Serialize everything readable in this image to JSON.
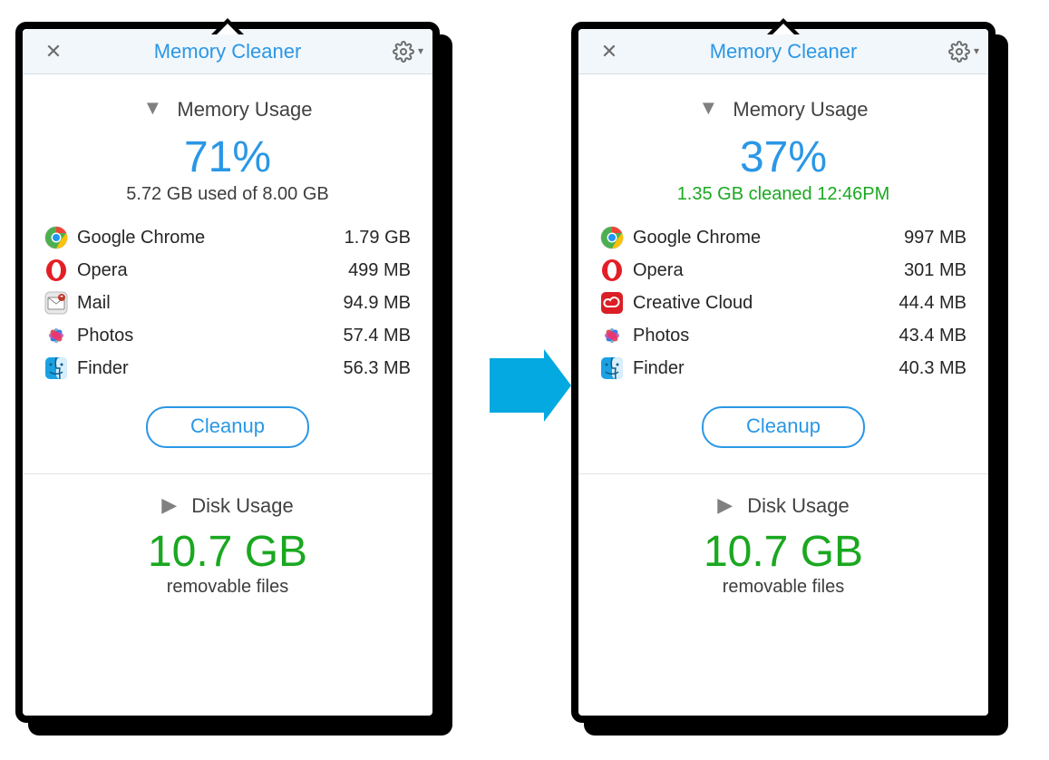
{
  "left": {
    "title": "Memory Cleaner",
    "memory": {
      "section_label": "Memory Usage",
      "percent": "71%",
      "subline": "5.72 GB used of 8.00 GB",
      "subline_green": false,
      "cleanup_label": "Cleanup",
      "apps": [
        {
          "icon": "chrome",
          "name": "Google Chrome",
          "value": "1.79 GB"
        },
        {
          "icon": "opera",
          "name": "Opera",
          "value": "499 MB"
        },
        {
          "icon": "mail",
          "name": "Mail",
          "value": "94.9 MB"
        },
        {
          "icon": "photos",
          "name": "Photos",
          "value": "57.4 MB"
        },
        {
          "icon": "finder",
          "name": "Finder",
          "value": "56.3 MB"
        }
      ]
    },
    "disk": {
      "section_label": "Disk Usage",
      "big": "10.7 GB",
      "sub": "removable files"
    }
  },
  "right": {
    "title": "Memory Cleaner",
    "memory": {
      "section_label": "Memory Usage",
      "percent": "37%",
      "subline": "1.35 GB cleaned 12:46PM",
      "subline_green": true,
      "cleanup_label": "Cleanup",
      "apps": [
        {
          "icon": "chrome",
          "name": "Google Chrome",
          "value": "997 MB"
        },
        {
          "icon": "opera",
          "name": "Opera",
          "value": "301 MB"
        },
        {
          "icon": "creativecloud",
          "name": "Creative Cloud",
          "value": "44.4 MB"
        },
        {
          "icon": "photos",
          "name": "Photos",
          "value": "43.4 MB"
        },
        {
          "icon": "finder",
          "name": "Finder",
          "value": "40.3 MB"
        }
      ]
    },
    "disk": {
      "section_label": "Disk Usage",
      "big": "10.7 GB",
      "sub": "removable files"
    }
  }
}
